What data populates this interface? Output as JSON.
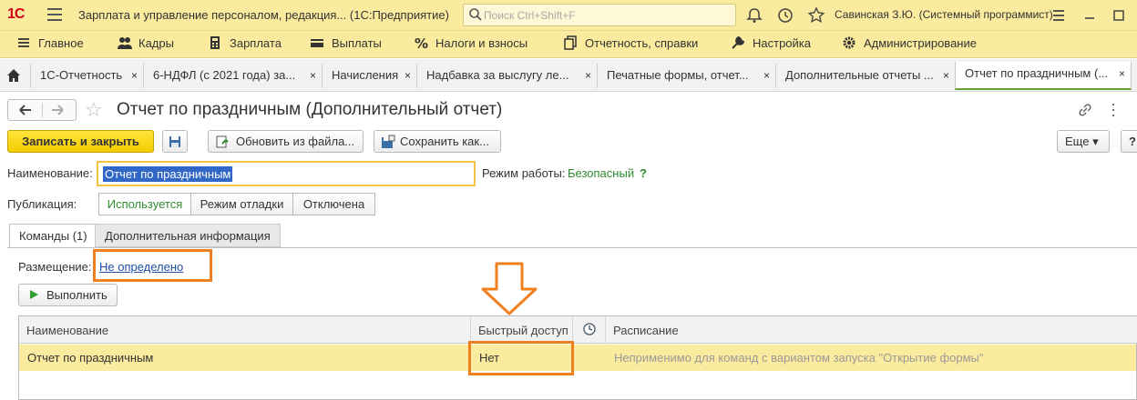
{
  "titlebar": {
    "logo": "1С",
    "app_title": "Зарплата и управление персоналом, редакция... (1С:Предприятие)",
    "search_placeholder": "Поиск Ctrl+Shift+F",
    "user": "Савинская З.Ю. (Системный программист)"
  },
  "main_menu": [
    {
      "label": "Главное",
      "icon": "menu-icon"
    },
    {
      "label": "Кадры",
      "icon": "people-icon"
    },
    {
      "label": "Зарплата",
      "icon": "calculator-icon"
    },
    {
      "label": "Выплаты",
      "icon": "wallet-icon"
    },
    {
      "label": "Налоги и взносы",
      "icon": "percent-icon"
    },
    {
      "label": "Отчетность, справки",
      "icon": "documents-icon"
    },
    {
      "label": "Настройка",
      "icon": "wrench-icon"
    },
    {
      "label": "Администрирование",
      "icon": "gear-icon"
    }
  ],
  "tabs": [
    {
      "label": "1С-Отчетность",
      "close": "×"
    },
    {
      "label": "6-НДФЛ (с 2021 года) за...",
      "close": "×"
    },
    {
      "label": "Начисления",
      "close": "×"
    },
    {
      "label": "Надбавка за выслугу ле...",
      "close": "×"
    },
    {
      "label": "Печатные формы, отчет...",
      "close": "×"
    },
    {
      "label": "Дополнительные отчеты ...",
      "close": "×"
    },
    {
      "label": "Отчет по праздничным (...",
      "close": "×"
    }
  ],
  "form": {
    "title": "Отчет по праздничным (Дополнительный отчет)",
    "toolbar": {
      "save_close": "Записать и закрыть",
      "update_from_file": "Обновить из файла...",
      "save_as": "Сохранить как...",
      "more": "Еще ▾",
      "help": "?"
    },
    "name_label": "Наименование:",
    "name_value": "Отчет по праздничным",
    "mode_label": "Режим работы:",
    "mode_value": "Безопасный",
    "mode_help": "?",
    "publication_label": "Публикация:",
    "publication_options": [
      "Используется",
      "Режим отладки",
      "Отключена"
    ],
    "publication_selected": "Используется",
    "panel_tabs": [
      "Команды (1)",
      "Дополнительная информация"
    ],
    "placement_label": "Размещение:",
    "placement_value": "Не определено",
    "run_button": "Выполнить",
    "grid": {
      "columns": [
        "Наименование",
        "Быстрый доступ",
        "",
        "Расписание"
      ],
      "rows": [
        {
          "name": "Отчет по праздничным",
          "quick_access": "Нет",
          "schedule": "Неприменимо для команд с вариантом запуска \"Открытие формы\""
        }
      ]
    }
  },
  "colors": {
    "accent_yellow": "#fbeb9e",
    "highlight_orange": "#f07f1f",
    "ok_green": "#2e8c2e",
    "selection_blue": "#3168c7"
  }
}
